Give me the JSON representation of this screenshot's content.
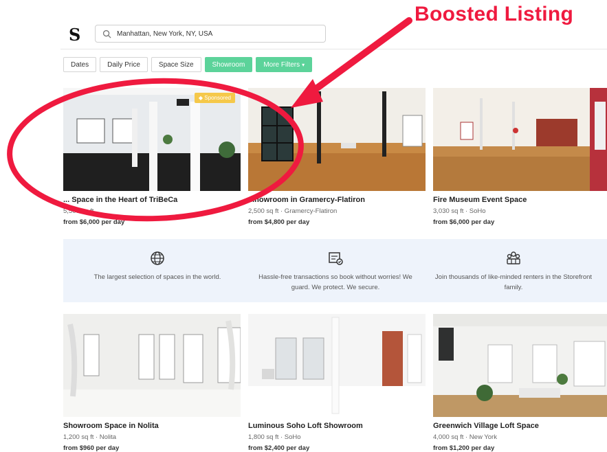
{
  "header": {
    "logo": "S",
    "search": {
      "value": "Manhattan, New York, NY, USA",
      "icon": "search-icon"
    }
  },
  "filters": [
    {
      "label": "Dates",
      "active": false
    },
    {
      "label": "Daily Price",
      "active": false
    },
    {
      "label": "Space Size",
      "active": false
    },
    {
      "label": "Showroom",
      "active": true
    },
    {
      "label": "More Filters",
      "active": true,
      "icon": "chevron-down-icon"
    }
  ],
  "listings_top": [
    {
      "title": "... Space in the Heart of TriBeCa",
      "meta": "5,500 sq ft",
      "price": "from $6,000 per day",
      "badge": "Sponsored"
    },
    {
      "title": "...howroom in Gramercy-Flatiron",
      "meta": "2,500 sq ft · Gramercy-Flatiron",
      "price": "from $4,800 per day"
    },
    {
      "title": "Fire Museum Event Space",
      "meta": "3,030 sq ft · SoHo",
      "price": "from $6,000 per day"
    }
  ],
  "features": [
    {
      "icon": "globe-icon",
      "text": "The largest selection of spaces in the world."
    },
    {
      "icon": "shield-icon",
      "text": "Hassle-free transactions so book without worries! We guard. We protect. We secure."
    },
    {
      "icon": "community-icon",
      "text": "Join thousands of like-minded renters in the Storefront family."
    }
  ],
  "listings_bottom": [
    {
      "title": "Showroom Space in Nolita",
      "meta": "1,200 sq ft · Nolita",
      "price": "from $960 per day"
    },
    {
      "title": "Luminous Soho Loft Showroom",
      "meta": "1,800 sq ft · SoHo",
      "price": "from $2,400 per day"
    },
    {
      "title": "Greenwich Village Loft Space",
      "meta": "4,000 sq ft · New York",
      "price": "from $1,200 per day"
    }
  ],
  "annotation": {
    "label": "Boosted Listing",
    "color": "#ef1a3f"
  },
  "colors": {
    "accent": "#5cd39a",
    "sponsored": "#f5c84a",
    "banner": "#eef3fb"
  }
}
